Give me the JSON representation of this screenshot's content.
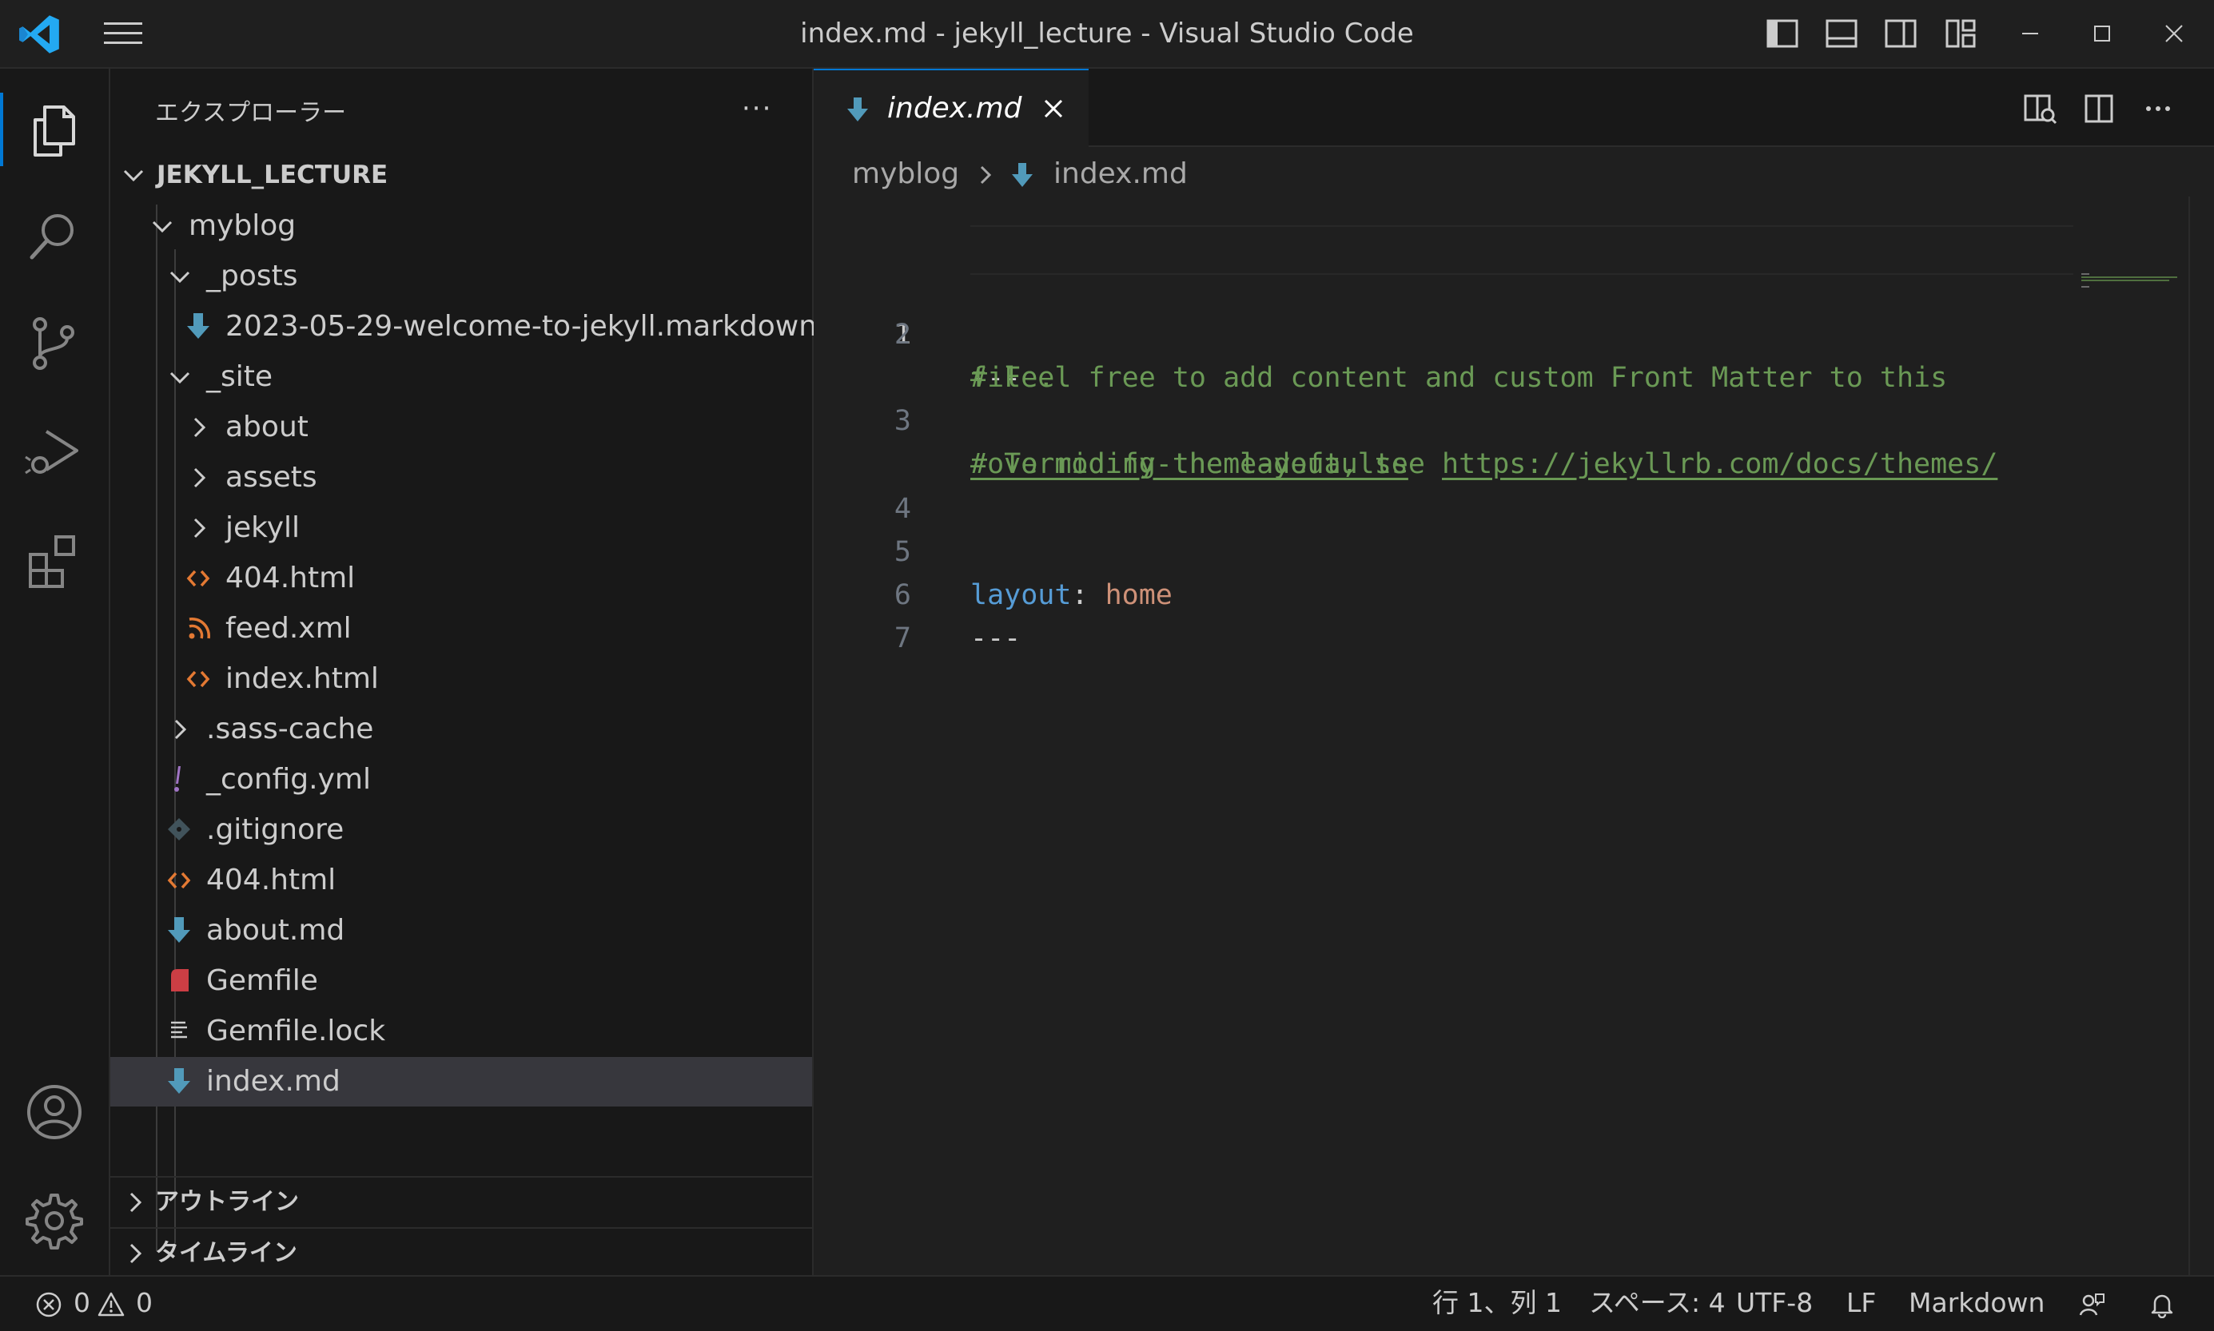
{
  "window": {
    "title": "index.md - jekyll_lecture - Visual Studio Code"
  },
  "titlebar_icons": [
    "toggle-primary-sidebar-icon",
    "toggle-panel-icon",
    "toggle-secondary-sidebar-icon",
    "customize-layout-icon",
    "minimize-icon",
    "maximize-icon",
    "close-icon"
  ],
  "activity_bar": [
    "explorer-icon",
    "search-icon",
    "source-control-icon",
    "run-debug-icon",
    "extensions-icon",
    "accounts-icon",
    "manage-gear-icon"
  ],
  "sidebar": {
    "header": "エクスプローラー",
    "more": "···",
    "workspace": "JEKYLL_LECTURE",
    "tree": [
      {
        "label": "myblog",
        "kind": "folder-open"
      },
      {
        "label": "_posts",
        "kind": "folder-open"
      },
      {
        "label": "2023-05-29-welcome-to-jekyll.markdown",
        "kind": "markdown"
      },
      {
        "label": "_site",
        "kind": "folder-open"
      },
      {
        "label": "about",
        "kind": "folder-closed"
      },
      {
        "label": "assets",
        "kind": "folder-closed"
      },
      {
        "label": "jekyll",
        "kind": "folder-closed"
      },
      {
        "label": "404.html",
        "kind": "html"
      },
      {
        "label": "feed.xml",
        "kind": "rss"
      },
      {
        "label": "index.html",
        "kind": "html"
      },
      {
        "label": ".sass-cache",
        "kind": "folder-closed"
      },
      {
        "label": "_config.yml",
        "kind": "yaml"
      },
      {
        "label": ".gitignore",
        "kind": "git"
      },
      {
        "label": "404.html",
        "kind": "html"
      },
      {
        "label": "about.md",
        "kind": "markdown"
      },
      {
        "label": "Gemfile",
        "kind": "ruby"
      },
      {
        "label": "Gemfile.lock",
        "kind": "lines"
      },
      {
        "label": "index.md",
        "kind": "markdown",
        "selected": true
      }
    ],
    "sections": {
      "outline": "アウトライン",
      "timeline": "タイムライン"
    }
  },
  "editor": {
    "tab": {
      "label": "index.md"
    },
    "breadcrumb": {
      "folder": "myblog",
      "file": "index.md"
    },
    "current_line": 1,
    "lines": {
      "l1": {
        "num": "1",
        "text": "---"
      },
      "l2": {
        "num": "2",
        "text": "# Feel free to add content and custom Front Matter to this",
        "wrap": "file."
      },
      "l3": {
        "num": "3",
        "prefix": "# To modify the layout, see ",
        "link": "https://jekyllrb.com/docs/themes/",
        "wrap": "#overriding-theme-defaults"
      },
      "l4": {
        "num": "4",
        "text": ""
      },
      "l5": {
        "num": "5",
        "key": "layout",
        "sep": ":",
        "value": " home"
      },
      "l6": {
        "num": "6",
        "text": "---"
      },
      "l7": {
        "num": "7",
        "text": ""
      }
    }
  },
  "status_bar": {
    "errors": "0",
    "warnings": "0",
    "position": "行 1、列 1",
    "indent": "スペース: 4",
    "encoding": "UTF-8",
    "eol": "LF",
    "language": "Markdown"
  },
  "colors": {
    "accent": "#0078d4",
    "comment": "#6a9955",
    "key": "#569cd6",
    "value": "#ce9178",
    "html_icon": "#e37933",
    "markdown_icon": "#519aba",
    "yaml_icon": "#a074c4",
    "ruby_icon": "#cc3e44"
  }
}
